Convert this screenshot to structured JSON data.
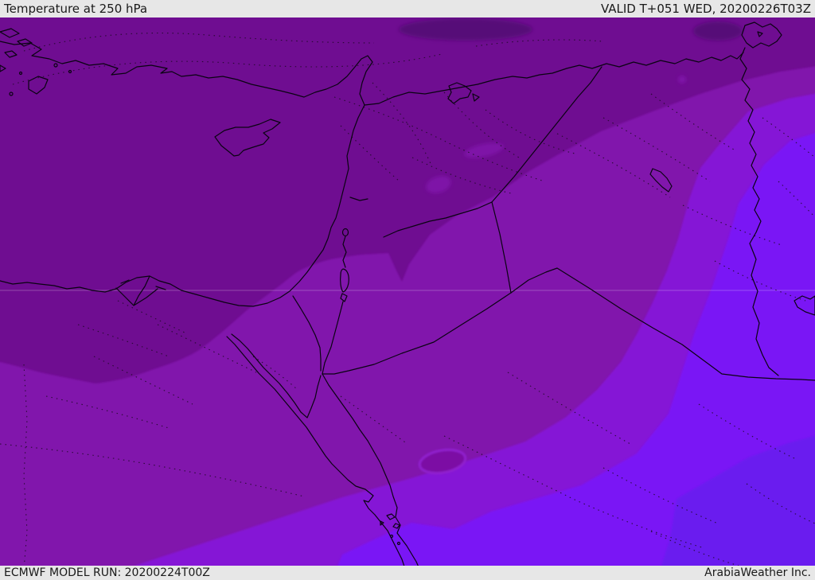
{
  "header": {
    "title": "Temperature at 250 hPa",
    "valid_label": "VALID T+051 WED, 20200226T03Z"
  },
  "footer": {
    "model_run_label": "ECMWF MODEL RUN: 20200224T00Z",
    "credit_label": "ArabiaWeather Inc."
  },
  "map": {
    "parameter": "Temperature",
    "level": "250 hPa",
    "colors": {
      "coldest_blob": "#560978",
      "very_cold_base": "#6F0D91",
      "cold_band": "#8113AC",
      "mild_band": "#8516D6",
      "warm_band": "#7A13F5",
      "warmest_band": "#6B1BEF",
      "coastline": "#0a0312",
      "dotted_admin": "#1c0a22",
      "graticule": "rgba(255,255,255,0.25)",
      "panel_bg": "#e7e7e7",
      "panel_text": "#1a1a1a"
    }
  }
}
